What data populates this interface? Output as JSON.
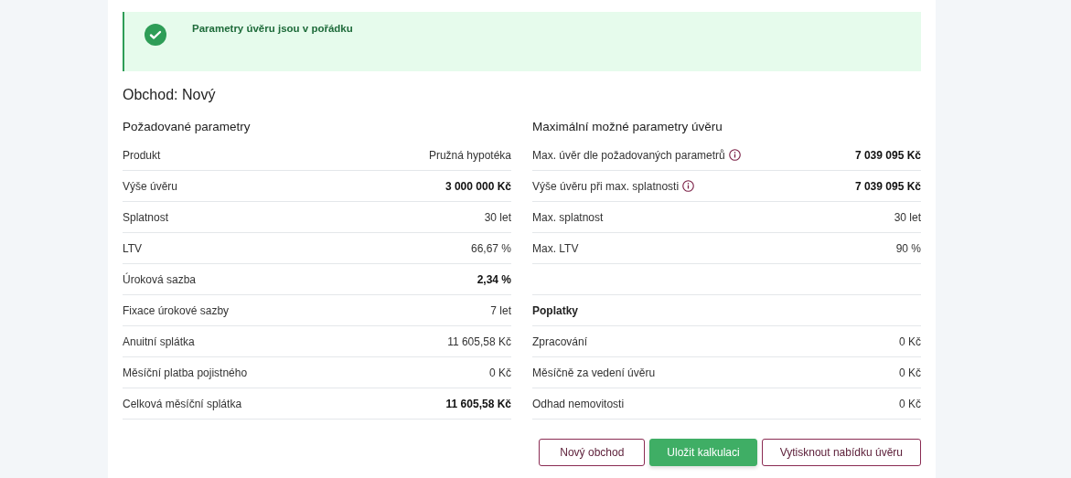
{
  "alert": {
    "kind": "success",
    "message": "Parametry úvěru jsou v pořádku"
  },
  "title": "Obchod: Nový",
  "columns": [
    {
      "heading": "Požadované parametry",
      "rows": [
        {
          "kind": "row",
          "label": "Produkt",
          "value": "Pružná hypotéka",
          "bold": false,
          "info": false
        },
        {
          "kind": "row",
          "label": "Výše úvěru",
          "value": "3 000 000 Kč",
          "bold": true,
          "info": false
        },
        {
          "kind": "row",
          "label": "Splatnost",
          "value": "30 let",
          "bold": false,
          "info": false
        },
        {
          "kind": "row",
          "label": "LTV",
          "value": "66,67 %",
          "bold": false,
          "info": false
        },
        {
          "kind": "row",
          "label": "Úroková sazba",
          "value": "2,34 %",
          "bold": true,
          "info": false
        },
        {
          "kind": "row",
          "label": "Fixace úrokové sazby",
          "value": "7 let",
          "bold": false,
          "info": false
        },
        {
          "kind": "row",
          "label": "Anuitní splátka",
          "value": "11 605,58 Kč",
          "bold": false,
          "info": false
        },
        {
          "kind": "row",
          "label": "Měsíční platba pojistného",
          "value": "0 Kč",
          "bold": false,
          "info": false
        },
        {
          "kind": "row",
          "label": "Celková měsíční splátka",
          "value": "11 605,58 Kč",
          "bold": true,
          "info": false
        }
      ]
    },
    {
      "heading": "Maximální možné parametry úvěru",
      "rows": [
        {
          "kind": "row",
          "label": "Max. úvěr dle požadovaných parametrů",
          "value": "7 039 095 Kč",
          "bold": true,
          "info": true
        },
        {
          "kind": "row",
          "label": "Výše úvěru při max. splatnosti",
          "value": "7 039 095 Kč",
          "bold": true,
          "info": true
        },
        {
          "kind": "row",
          "label": "Max. splatnost",
          "value": "30 let",
          "bold": false,
          "info": false
        },
        {
          "kind": "row",
          "label": "Max. LTV",
          "value": "90 %",
          "bold": false,
          "info": false
        },
        {
          "kind": "blank"
        },
        {
          "kind": "heading",
          "label": "Poplatky"
        },
        {
          "kind": "row",
          "label": "Zpracování",
          "value": "0 Kč",
          "bold": false,
          "info": false
        },
        {
          "kind": "row",
          "label": "Měsíčně za vedení úvěru",
          "value": "0 Kč",
          "bold": false,
          "info": false
        },
        {
          "kind": "row",
          "label": "Odhad nemovitosti",
          "value": "0 Kč",
          "bold": false,
          "info": false
        }
      ]
    }
  ],
  "buttons": [
    {
      "label": "Nový obchod",
      "kind": "outline"
    },
    {
      "label": "Uložit kalkulaci",
      "kind": "primary"
    },
    {
      "label": "Vytisknout nabídku úvěru",
      "kind": "outline"
    }
  ]
}
